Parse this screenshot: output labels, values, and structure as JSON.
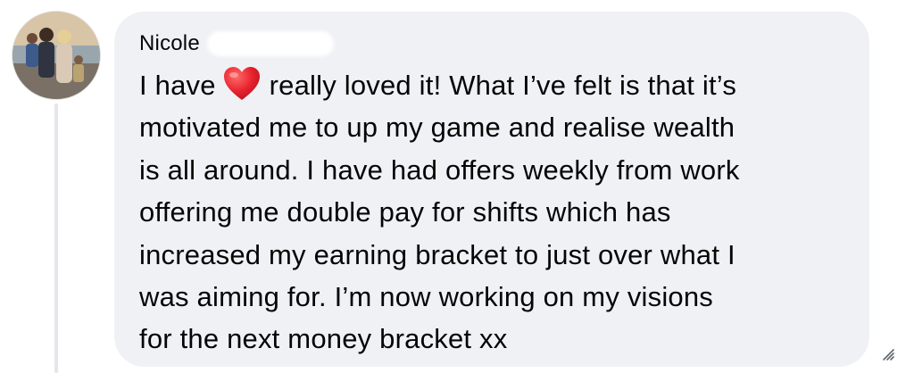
{
  "comment": {
    "author": "Nicole",
    "text_before_emoji": "I have",
    "emoji": "heart-emoji",
    "text_after_emoji": "really loved it! What I’ve felt is that it’s",
    "lines": [
      "motivated me to up my game and realise wealth",
      "is all around. I have had offers weekly from work",
      "offering me double pay for shifts which has",
      "increased my earning bracket to just over what I",
      "was aiming for. I’m now working on my visions",
      "for the next money bracket xx"
    ]
  },
  "icons": {
    "avatar": "profile-photo",
    "resize": "resize-handle-icon"
  },
  "colors": {
    "bubble": "#f0f1f5",
    "text": "#050505",
    "heart": "#e4232f",
    "thread_line": "#e4e6ea"
  }
}
